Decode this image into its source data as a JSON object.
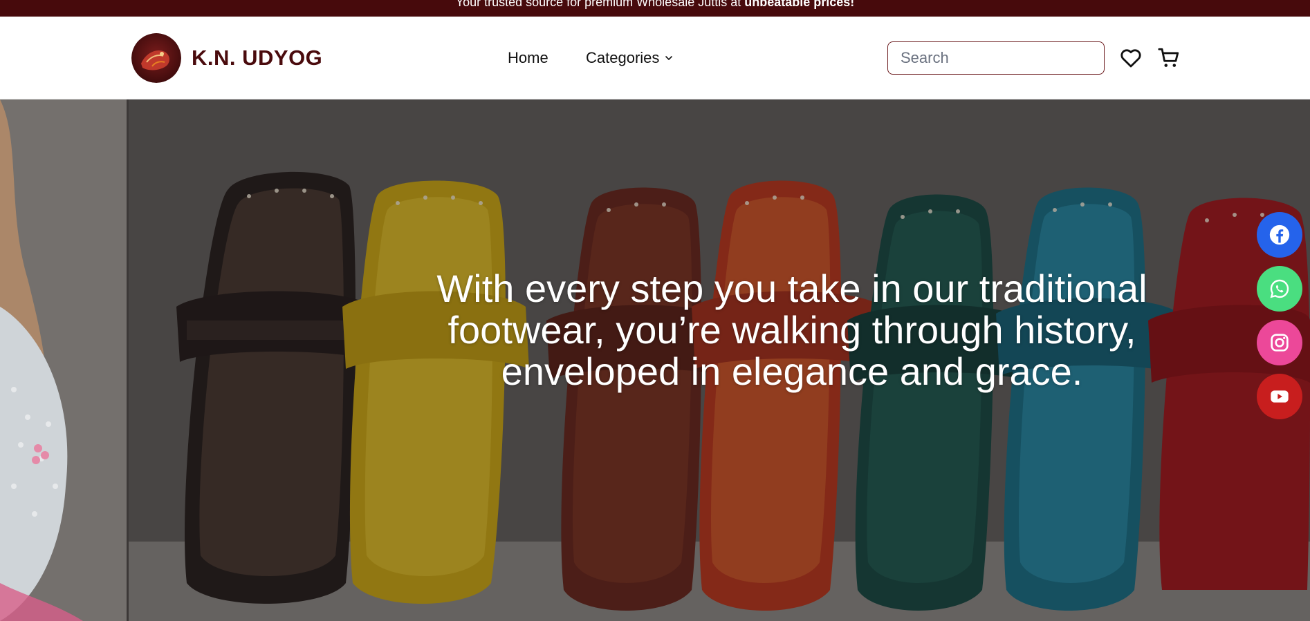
{
  "announcement": {
    "text": "Your trusted source for premium Wholesale Juttis at ",
    "bold": "unbeatable prices!"
  },
  "header": {
    "brand": "K.N. UDYOG",
    "logo_icon": "jutti-logo-icon",
    "nav": {
      "home": "Home",
      "categories": "Categories"
    },
    "search": {
      "placeholder": "Search",
      "value": ""
    },
    "icons": [
      "heart-icon",
      "cart-icon"
    ]
  },
  "hero": {
    "line1": "With every step you take in our traditional",
    "line2": "footwear, you’re walking through history,",
    "line3": "enveloped in elegance and grace."
  },
  "social": [
    "facebook-icon",
    "whatsapp-icon",
    "instagram-icon",
    "youtube-icon"
  ],
  "colors": {
    "brand_maroon": "#470a0c",
    "facebook": "#2563eb",
    "whatsapp": "#4ade80",
    "instagram": "#ec4899",
    "youtube": "#c81e1e"
  }
}
